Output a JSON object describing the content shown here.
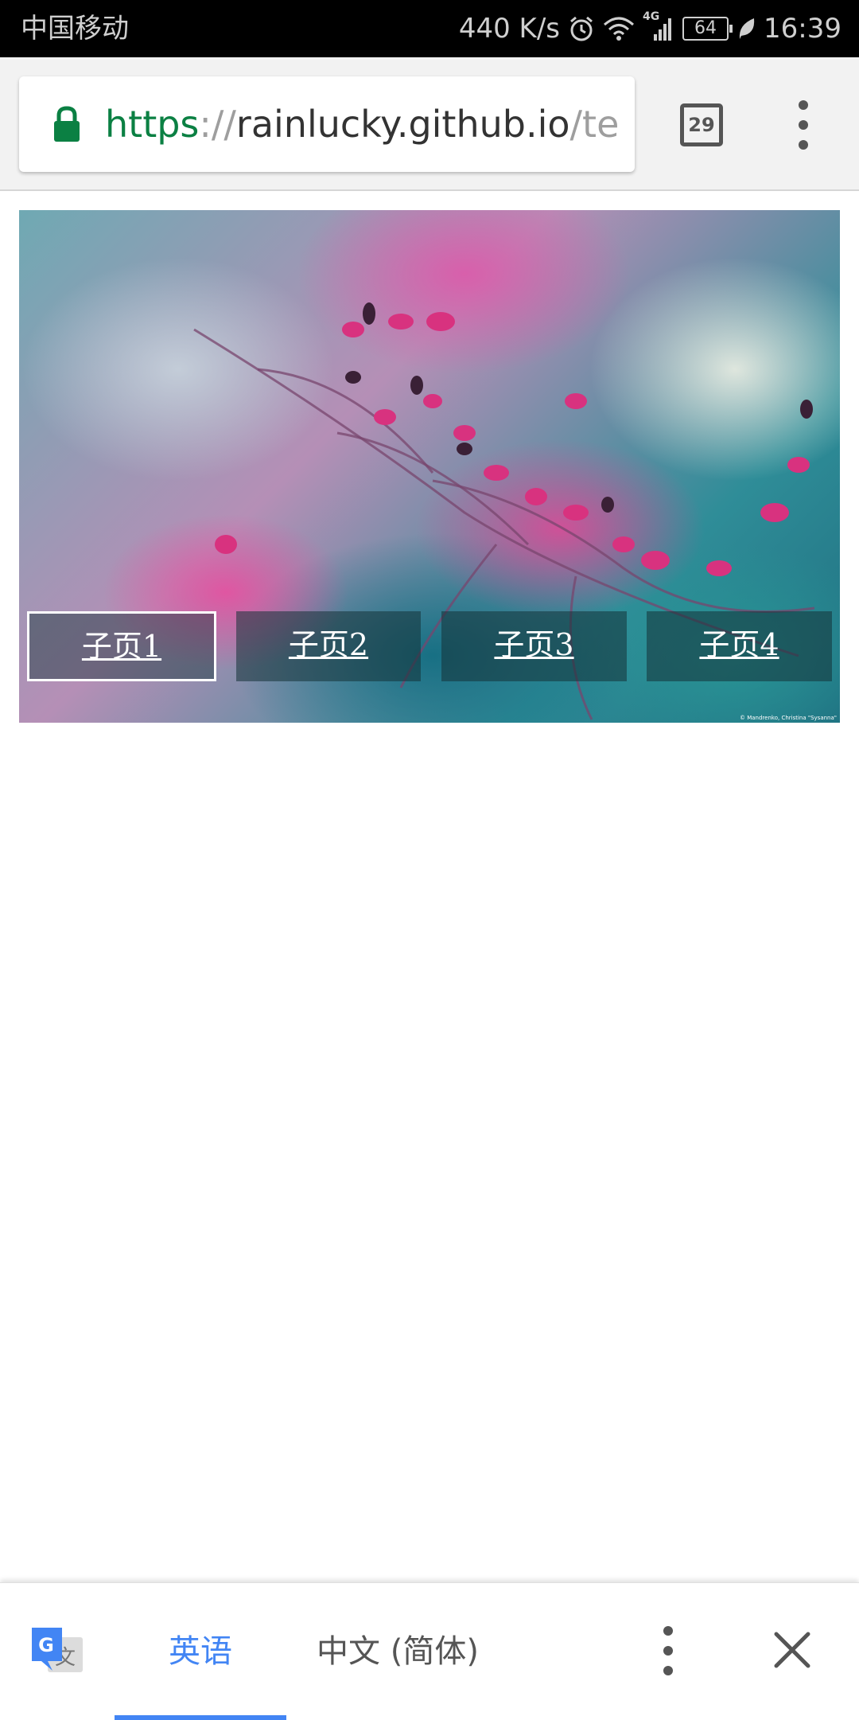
{
  "status_bar": {
    "carrier": "中国移动",
    "net_speed": "440 K/s",
    "network_type": "4G",
    "battery": "64",
    "time": "16:39",
    "icons": [
      "alarm-icon",
      "wifi-icon",
      "signal-icon",
      "battery-icon",
      "leaf-icon"
    ]
  },
  "browser": {
    "url": {
      "scheme": "https",
      "separator": "://",
      "host": "rainlucky.github.io",
      "path": "/tenc"
    },
    "tab_count": "29",
    "accent_color": "#0b8043"
  },
  "hero": {
    "tabs": [
      {
        "label": "子页1",
        "active": true
      },
      {
        "label": "子页2",
        "active": false
      },
      {
        "label": "子页3",
        "active": false
      },
      {
        "label": "子页4",
        "active": false
      }
    ],
    "credit": "© Mandrenko, Christina \"Sysanna\""
  },
  "translate_bar": {
    "source_language": "英语",
    "target_language": "中文 (简体)",
    "accent_color": "#4285f4"
  }
}
